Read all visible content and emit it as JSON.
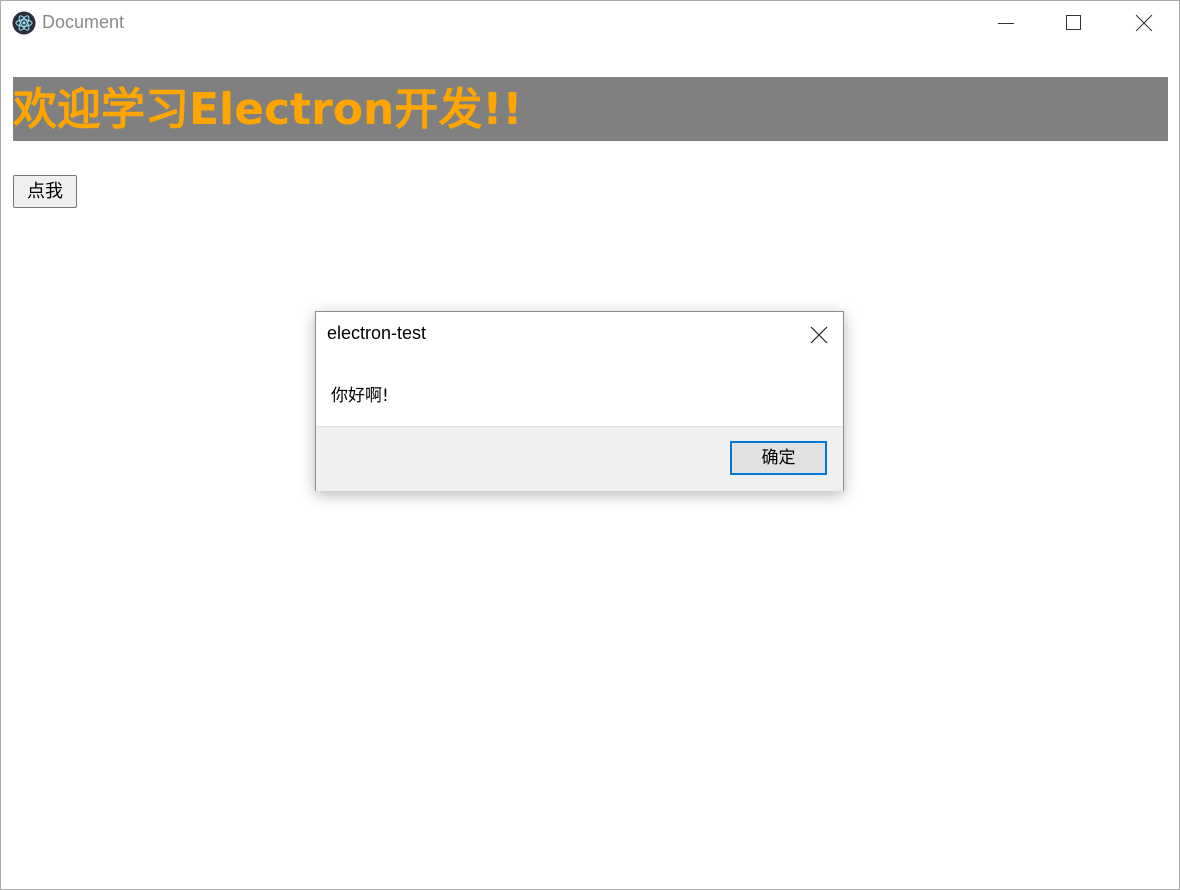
{
  "window": {
    "title": "Document",
    "icon": "electron-icon"
  },
  "controls": {
    "minimize": "minimize-icon",
    "maximize": "maximize-icon",
    "close": "close-icon"
  },
  "page": {
    "heading": "欢迎学习Electron开发!!",
    "heading_color": "#ffa500",
    "heading_background": "#808080",
    "button_label": "点我"
  },
  "dialog": {
    "title": "electron-test",
    "message": "你好啊!",
    "ok_label": "确定",
    "accent_color": "#0078d7"
  }
}
